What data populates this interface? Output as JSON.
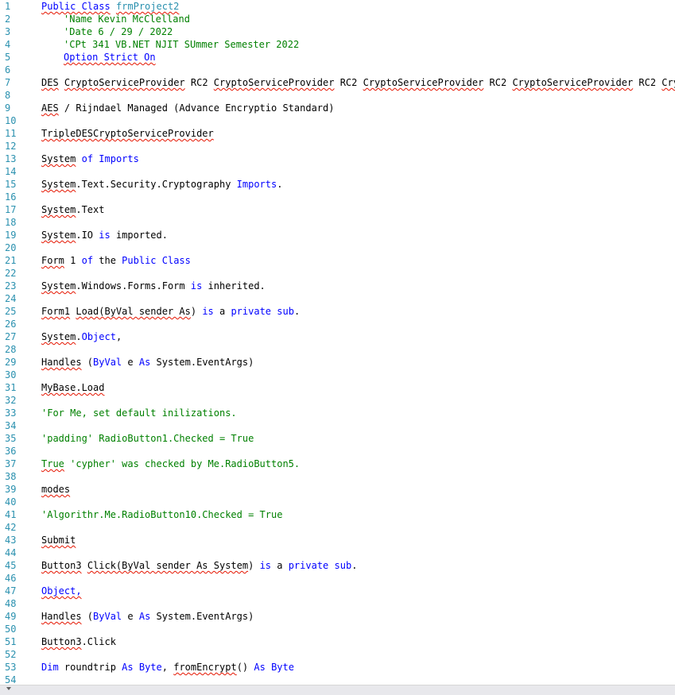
{
  "editor": {
    "lines": [
      {
        "n": "1",
        "seg": [
          {
            "t": "Public Class",
            "c": "kw",
            "sq": true
          },
          {
            "t": " "
          },
          {
            "t": "frmProject2",
            "c": "ty",
            "sq": true
          }
        ]
      },
      {
        "n": "2",
        "ind": true,
        "seg": [
          {
            "t": "'Name Kevin McClelland",
            "c": "cm"
          }
        ]
      },
      {
        "n": "3",
        "ind": true,
        "seg": [
          {
            "t": "'Date 6 / 29 / 2022",
            "c": "cm"
          }
        ]
      },
      {
        "n": "4",
        "ind": true,
        "seg": [
          {
            "t": "'CPt 341 VB.NET NJIT SUmmer Semester 2022",
            "c": "cm"
          }
        ]
      },
      {
        "n": "5",
        "ind": true,
        "seg": [
          {
            "t": "Option Strict On",
            "c": "kw",
            "sq": true
          }
        ]
      },
      {
        "n": "6",
        "seg": []
      },
      {
        "n": "7",
        "seg": [
          {
            "t": "DES",
            "sq": true
          },
          {
            "t": " "
          },
          {
            "t": "CryptoServiceProvider",
            "sq": true
          },
          {
            "t": " RC2 "
          },
          {
            "t": "CryptoServiceProvider",
            "sq": true
          },
          {
            "t": " RC2 "
          },
          {
            "t": "CryptoServiceProvider",
            "sq": true
          },
          {
            "t": " RC2 "
          },
          {
            "t": "CryptoServiceProvider",
            "sq": true
          },
          {
            "t": " RC2 "
          },
          {
            "t": "CryptoServiceProvider",
            "sq": true
          }
        ]
      },
      {
        "n": "8",
        "seg": []
      },
      {
        "n": "9",
        "seg": [
          {
            "t": "AES",
            "sq": true
          },
          {
            "t": " / Rijndael Managed (Advance Encryptio Standard)"
          }
        ]
      },
      {
        "n": "10",
        "seg": []
      },
      {
        "n": "11",
        "seg": [
          {
            "t": "TripleDESCryptoServiceProvider",
            "sq": true
          }
        ]
      },
      {
        "n": "12",
        "seg": []
      },
      {
        "n": "13",
        "seg": [
          {
            "t": "System",
            "sq": true
          },
          {
            "t": " "
          },
          {
            "t": "of",
            "c": "kw"
          },
          {
            "t": " "
          },
          {
            "t": "Imports",
            "c": "kw"
          }
        ]
      },
      {
        "n": "14",
        "seg": []
      },
      {
        "n": "15",
        "seg": [
          {
            "t": "System",
            "sq": true
          },
          {
            "t": ".Text.Security.Cryptography "
          },
          {
            "t": "Imports",
            "c": "kw"
          },
          {
            "t": "."
          }
        ]
      },
      {
        "n": "16",
        "seg": []
      },
      {
        "n": "17",
        "seg": [
          {
            "t": "System",
            "sq": true
          },
          {
            "t": ".Text"
          }
        ]
      },
      {
        "n": "18",
        "seg": []
      },
      {
        "n": "19",
        "seg": [
          {
            "t": "System",
            "sq": true
          },
          {
            "t": ".IO "
          },
          {
            "t": "is",
            "c": "kw"
          },
          {
            "t": " imported."
          }
        ]
      },
      {
        "n": "20",
        "seg": []
      },
      {
        "n": "21",
        "seg": [
          {
            "t": "Form",
            "sq": true
          },
          {
            "t": " 1 "
          },
          {
            "t": "of",
            "c": "kw"
          },
          {
            "t": " the "
          },
          {
            "t": "Public Class",
            "c": "kw"
          }
        ]
      },
      {
        "n": "22",
        "seg": []
      },
      {
        "n": "23",
        "seg": [
          {
            "t": "System",
            "sq": true
          },
          {
            "t": ".Windows.Forms.Form "
          },
          {
            "t": "is",
            "c": "kw"
          },
          {
            "t": " inherited."
          }
        ]
      },
      {
        "n": "24",
        "seg": []
      },
      {
        "n": "25",
        "seg": [
          {
            "t": "Form1",
            "sq": true
          },
          {
            "t": " "
          },
          {
            "t": "Load(ByVal sender As",
            "sq": true
          },
          {
            "t": ") "
          },
          {
            "t": "is",
            "c": "kw"
          },
          {
            "t": " a "
          },
          {
            "t": "private sub",
            "c": "kw"
          },
          {
            "t": "."
          }
        ]
      },
      {
        "n": "26",
        "seg": []
      },
      {
        "n": "27",
        "seg": [
          {
            "t": "System",
            "sq": true
          },
          {
            "t": "."
          },
          {
            "t": "Object",
            "c": "kw"
          },
          {
            "t": ","
          }
        ]
      },
      {
        "n": "28",
        "seg": []
      },
      {
        "n": "29",
        "seg": [
          {
            "t": "Handles",
            "sq": true
          },
          {
            "t": " ("
          },
          {
            "t": "ByVal",
            "c": "kw"
          },
          {
            "t": " e "
          },
          {
            "t": "As",
            "c": "kw"
          },
          {
            "t": " System.EventArgs)"
          }
        ]
      },
      {
        "n": "30",
        "seg": []
      },
      {
        "n": "31",
        "seg": [
          {
            "t": "MyBase.Load",
            "sq": true
          }
        ]
      },
      {
        "n": "32",
        "seg": []
      },
      {
        "n": "33",
        "seg": [
          {
            "t": "'For Me, set default inilizations.",
            "c": "cm"
          }
        ]
      },
      {
        "n": "34",
        "seg": []
      },
      {
        "n": "35",
        "seg": [
          {
            "t": "'padding'",
            "c": "cm"
          },
          {
            "t": " RadioButton1.Checked = True",
            "c": "cm"
          }
        ]
      },
      {
        "n": "36",
        "seg": []
      },
      {
        "n": "37",
        "seg": [
          {
            "t": "True",
            "c": "cm",
            "sq": true
          },
          {
            "t": " 'cypher' was checked by Me.RadioButton5.",
            "c": "cm"
          }
        ]
      },
      {
        "n": "38",
        "seg": []
      },
      {
        "n": "39",
        "seg": [
          {
            "t": "modes",
            "sq": true
          }
        ]
      },
      {
        "n": "40",
        "seg": []
      },
      {
        "n": "41",
        "seg": [
          {
            "t": "'Algorithr.Me.RadioButton10.Checked = True",
            "c": "cm"
          }
        ]
      },
      {
        "n": "42",
        "seg": []
      },
      {
        "n": "43",
        "seg": [
          {
            "t": "Submit",
            "sq": true
          }
        ]
      },
      {
        "n": "44",
        "seg": []
      },
      {
        "n": "45",
        "seg": [
          {
            "t": "Button3",
            "sq": true
          },
          {
            "t": " "
          },
          {
            "t": "Click(ByVal sender As System",
            "sq": true
          },
          {
            "t": ") "
          },
          {
            "t": "is",
            "c": "kw"
          },
          {
            "t": " a "
          },
          {
            "t": "private sub",
            "c": "kw"
          },
          {
            "t": "."
          }
        ]
      },
      {
        "n": "46",
        "seg": []
      },
      {
        "n": "47",
        "seg": [
          {
            "t": "Object,",
            "c": "kw",
            "sq": true
          }
        ]
      },
      {
        "n": "48",
        "seg": []
      },
      {
        "n": "49",
        "seg": [
          {
            "t": "Handles",
            "sq": true
          },
          {
            "t": " ("
          },
          {
            "t": "ByVal",
            "c": "kw"
          },
          {
            "t": " e "
          },
          {
            "t": "As",
            "c": "kw"
          },
          {
            "t": " System.EventArgs)"
          }
        ]
      },
      {
        "n": "50",
        "seg": []
      },
      {
        "n": "51",
        "seg": [
          {
            "t": "Button3",
            "sq": true
          },
          {
            "t": ".Click"
          }
        ]
      },
      {
        "n": "52",
        "seg": []
      },
      {
        "n": "53",
        "seg": [
          {
            "t": "Dim",
            "c": "kw"
          },
          {
            "t": " roundtrip "
          },
          {
            "t": "As",
            "c": "kw"
          },
          {
            "t": " "
          },
          {
            "t": "Byte",
            "c": "kw"
          },
          {
            "t": ", "
          },
          {
            "t": "fromEncrypt",
            "sq": true
          },
          {
            "t": "() "
          },
          {
            "t": "As",
            "c": "kw"
          },
          {
            "t": " "
          },
          {
            "t": "Byte",
            "c": "kw"
          }
        ]
      },
      {
        "n": "54",
        "seg": []
      }
    ]
  },
  "scrollbar": {
    "icon": "chevron-down-icon"
  }
}
